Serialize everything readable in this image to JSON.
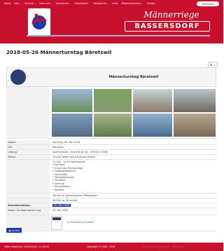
{
  "nav": {
    "items": [
      "Home",
      "Info ⌄",
      "Termine ⌄",
      "Über uns ⌄",
      "Turnbetrieb ⌄",
      "Geselligkeit ⌄",
      "Fotogalerie ⌄",
      "Links",
      "Mitgliederbereich ⌄",
      "Suchen"
    ],
    "login_label": "Anmelden"
  },
  "brand": {
    "title": "Männerriege",
    "subtitle": "BASSERSDORF"
  },
  "page": {
    "title": "2018-05-26 Männerturntag Bäretswil",
    "share_label": "⚙ ⌄"
  },
  "event": {
    "heading": "Männerturntag Bäretswil",
    "rows": [
      {
        "key": "Datum:",
        "value": "Samstag, 26. Mai 2018"
      },
      {
        "key": "Ort:",
        "value": "Bäretswil"
      },
      {
        "key": "Leitung:",
        "value": "Josef Brändle | 044 836 82 56 · 079 613 74 86"
      },
      {
        "key": "Zeiten:",
        "value": "10:00h Treffpunkt Schulhaus Hirslen"
      }
    ],
    "program_lines": [
      "11:00h - 14:15 Wettkämpfe",
      "• Fachtest",
      "• Schulreise Männerriege",
      "• Gerätewettkampf",
      "• Gymnastik",
      "• Teamwettkampf",
      "• Faustball",
      "• Intercup",
      "• Steinstossen",
      "• Stafette"
    ],
    "extra_rows": [
      "16:00h ca. gemeinsames Mittagessen",
      "18:00h ca. Rückreise"
    ],
    "deadline_key": "Anmeldeschluss:",
    "deadline_value": "20. Mai 2018",
    "date_key": "Datum Turntagregistrierung",
    "date_value": "24. Mai 2018",
    "doc_link": "📎 Anmeldung Turntag"
  },
  "back_label": "◀ zurück",
  "footer": {
    "left": "Seite erstellt am: 06.04.2018 · 11:45:05",
    "center": "Copyright © 1928 - 2018",
    "right": "Männerriege Bassersdorf · Webmaster"
  },
  "colors": {
    "brand_red": "#c8102e",
    "badge_blue": "#1f3aa6"
  }
}
